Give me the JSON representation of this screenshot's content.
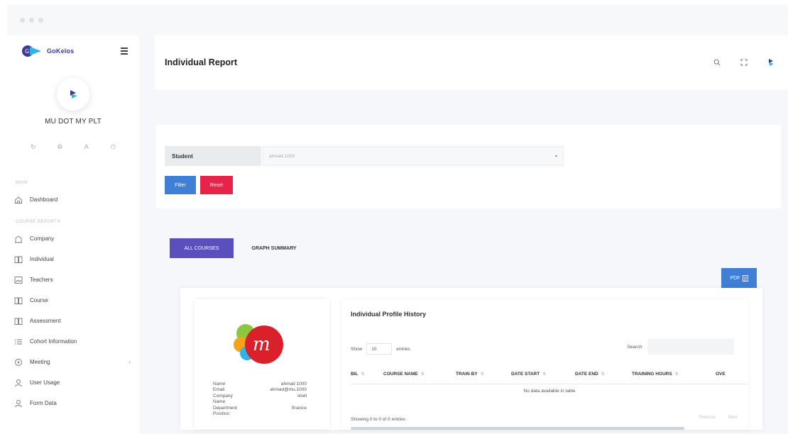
{
  "brand": {
    "name": "GoKelos"
  },
  "sidebar": {
    "org_name": "MU DOT MY PLT",
    "section_main": "MAIN",
    "section_reports": "COURSE REPORTS",
    "items": [
      {
        "label": "Dashboard",
        "icon": "home-icon"
      },
      {
        "label": "Company",
        "icon": "building-icon"
      },
      {
        "label": "Individual",
        "icon": "book-icon"
      },
      {
        "label": "Teachers",
        "icon": "image-icon"
      },
      {
        "label": "Course",
        "icon": "book-icon"
      },
      {
        "label": "Assessment",
        "icon": "book-icon"
      },
      {
        "label": "Cohort Information",
        "icon": "list-icon"
      },
      {
        "label": "Meeting",
        "icon": "video-icon"
      },
      {
        "label": "User Usage",
        "icon": "user-icon"
      },
      {
        "label": "Form Data",
        "icon": "user-icon"
      }
    ],
    "meeting_chevron": "›"
  },
  "header": {
    "title": "Individual Report"
  },
  "filter": {
    "student_label": "Student",
    "student_value": "ahmad 1000",
    "filter_label": "Filter",
    "reset_label": "Reset"
  },
  "tabs": {
    "all_courses": "ALL COURSES",
    "graph_summary": "GRAPH SUMMARY"
  },
  "pdf_label": "PDF",
  "profile": {
    "rows": [
      {
        "key": "Name",
        "value": "ahmad 1000"
      },
      {
        "key": "Email",
        "value": "ahmad@mu.1000"
      },
      {
        "key": "Company",
        "value": "shell"
      },
      {
        "key": "Name",
        "value": ""
      },
      {
        "key": "Department",
        "value": "finance"
      },
      {
        "key": "Position",
        "value": ""
      }
    ]
  },
  "history": {
    "title": "Individual Profile History",
    "show_label": "Show",
    "entries_value": "10",
    "entries_label": "entries",
    "search_label": "Search:",
    "columns": [
      "BIL",
      "COURSE NAME",
      "TRAIN BY",
      "DATE START",
      "DATE END",
      "TRAINING HOURS",
      "OVE"
    ],
    "empty_text": "No data available in table",
    "showing_text": "Showing 0 to 0 of 0 entries",
    "prev_label": "Previous",
    "next_label": "Next"
  },
  "colors": {
    "primary": "#3f7fd5",
    "danger": "#e8234a",
    "tab_active": "#5a4fbd",
    "brand": "#3b3a9a"
  }
}
